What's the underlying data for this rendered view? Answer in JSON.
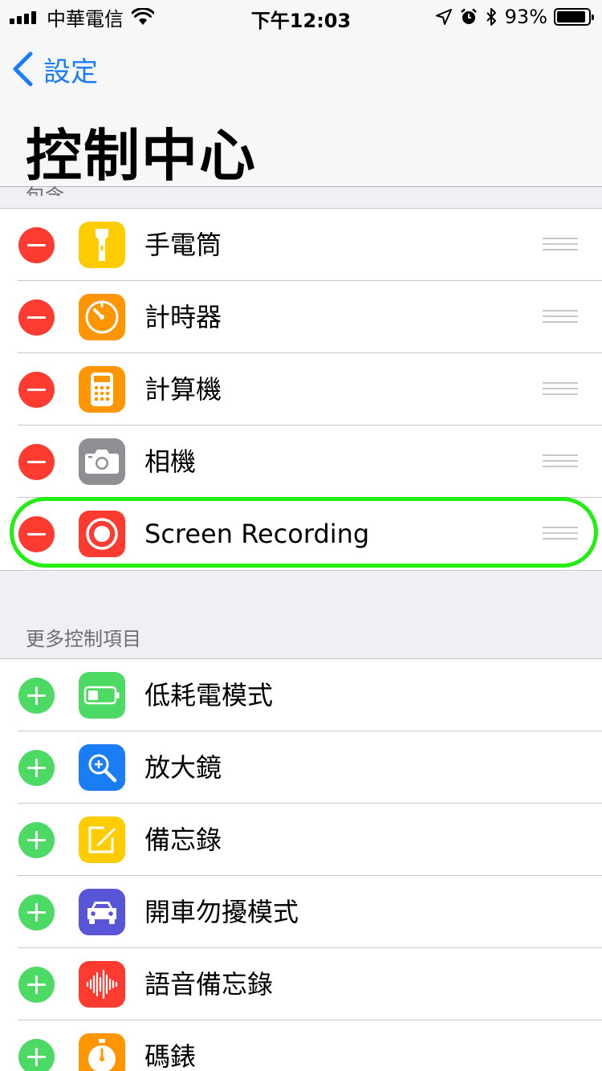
{
  "status_bar": {
    "carrier": "中華電信",
    "time": "下午12:03",
    "battery_percent": "93%",
    "battery_level": 0.93
  },
  "nav": {
    "back_label": "設定",
    "title": "控制中心"
  },
  "include_section": {
    "partial_header": "包含",
    "items": [
      {
        "label": "手電筒",
        "icon": "flashlight-icon",
        "color": "#ffcc00"
      },
      {
        "label": "計時器",
        "icon": "timer-icon",
        "color": "#ff9500"
      },
      {
        "label": "計算機",
        "icon": "calculator-icon",
        "color": "#ff9500"
      },
      {
        "label": "相機",
        "icon": "camera-icon",
        "color": "#8e8e93"
      },
      {
        "label": "Screen Recording",
        "icon": "screen-recording-icon",
        "color": "#fd3b30"
      }
    ]
  },
  "more_section": {
    "header": "更多控制項目",
    "items": [
      {
        "label": "低耗電模式",
        "icon": "low-power-battery-icon",
        "color": "#4cd964"
      },
      {
        "label": "放大鏡",
        "icon": "magnifier-icon",
        "color": "#1a7df6"
      },
      {
        "label": "備忘錄",
        "icon": "notes-icon",
        "color": "#ffcc00"
      },
      {
        "label": "開車勿擾模式",
        "icon": "car-icon",
        "color": "#5856d6"
      },
      {
        "label": "語音備忘錄",
        "icon": "voice-memo-icon",
        "color": "#fd3b30"
      },
      {
        "label": "碼錶",
        "icon": "stopwatch-icon",
        "color": "#ff9500"
      }
    ]
  },
  "colors": {
    "accent": "#1a7df6",
    "remove": "#fd3b30",
    "add": "#4cd964",
    "highlight": "#22ee11"
  }
}
